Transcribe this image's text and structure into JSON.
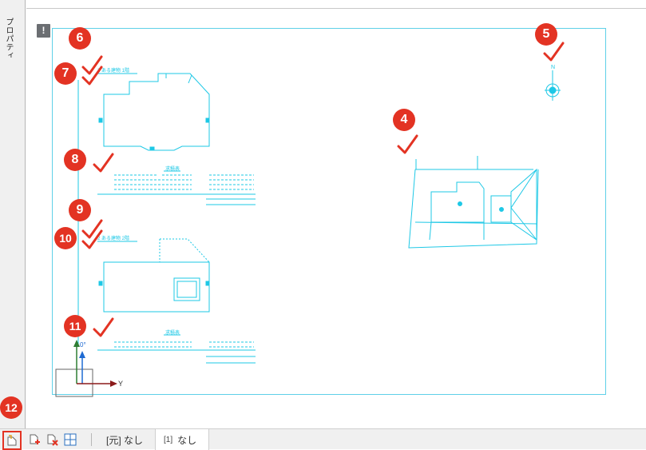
{
  "side_panel": {
    "label": "プロパティ"
  },
  "canvas": {
    "info_icon": "!"
  },
  "drawing": {
    "upper_title": "2 ある建物 1階",
    "lower_title": "2 ある建物 2階",
    "upper_table_title": "求積表",
    "lower_table_title": "求積表",
    "compass_label": "N",
    "axis_y_label": "Y",
    "axis_x_label": "0°"
  },
  "callouts": [
    "4",
    "5",
    "6",
    "7",
    "8",
    "9",
    "10",
    "11",
    "12"
  ],
  "status_bar": {
    "source_tab_label": "[元] なし",
    "current_tab_num": "[1]",
    "current_tab_label": "なし"
  },
  "colors": {
    "drawing": "#1ec8e6",
    "badge": "#e33323",
    "check": "#e33323"
  }
}
